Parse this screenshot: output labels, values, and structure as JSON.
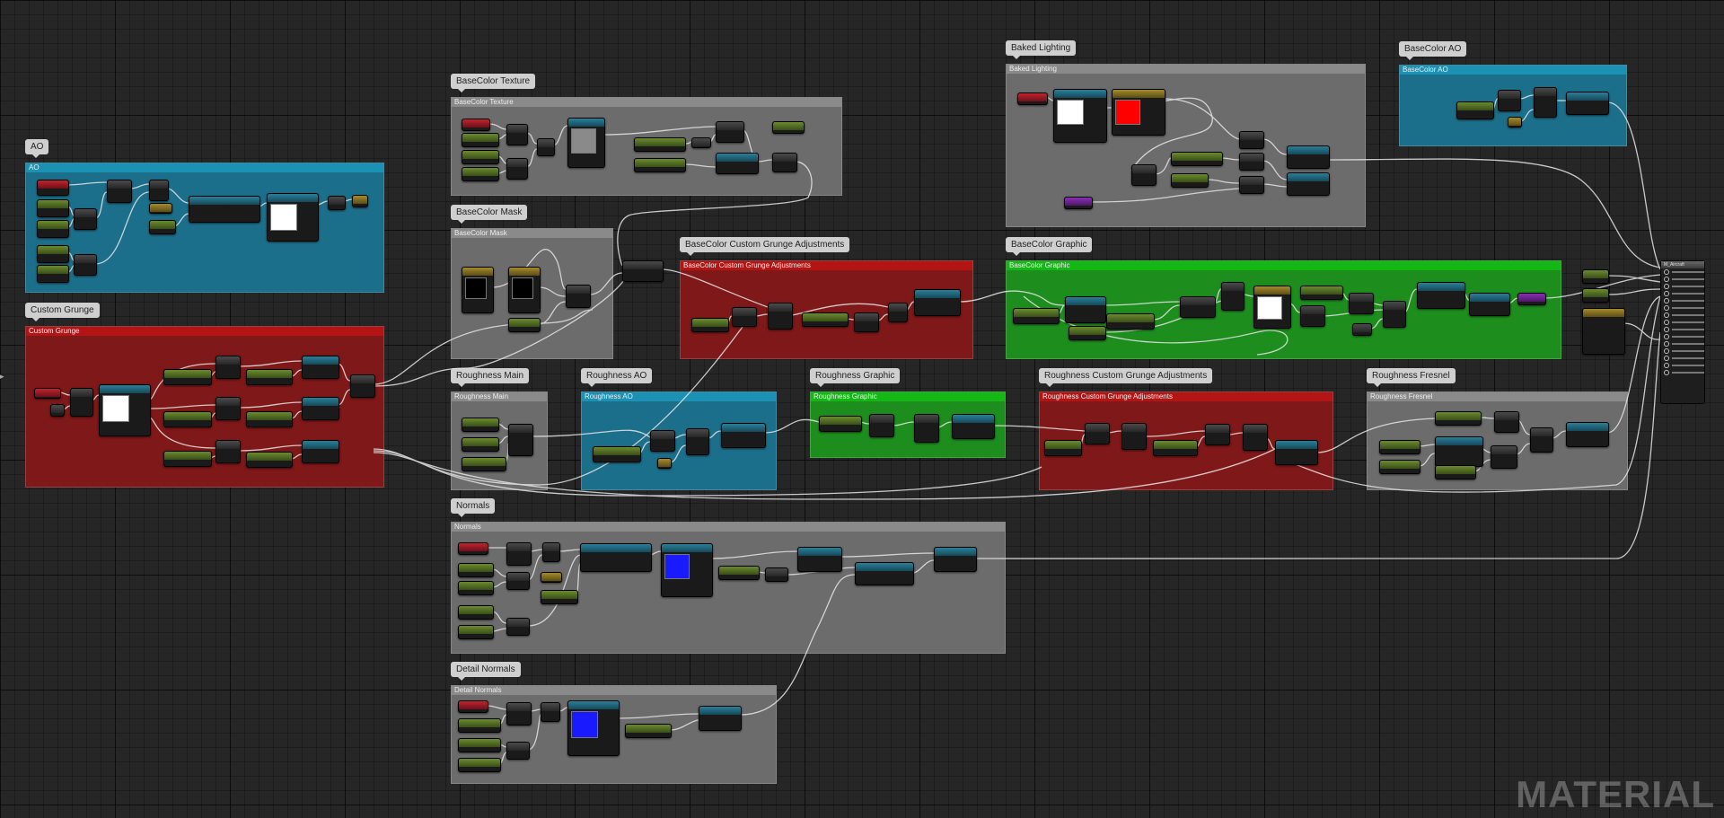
{
  "editor": {
    "watermark": "MATERIAL",
    "output_node_label": "M_Aircraft"
  },
  "comments": [
    {
      "id": "ao",
      "label": "AO",
      "header": "AO",
      "color": "teal"
    },
    {
      "id": "custom-grunge",
      "label": "Custom Grunge",
      "header": "Custom Grunge",
      "color": "red"
    },
    {
      "id": "basecolor-texture",
      "label": "BaseColor Texture",
      "header": "BaseColor Texture",
      "color": "gray"
    },
    {
      "id": "basecolor-mask",
      "label": "BaseColor Mask",
      "header": "BaseColor Mask",
      "color": "gray"
    },
    {
      "id": "basecolor-custom-grunge",
      "label": "BaseColor Custom Grunge Adjustments",
      "header": "BaseColor Custom Grunge Adjustments",
      "color": "red"
    },
    {
      "id": "baked-lighting",
      "label": "Baked Lighting",
      "header": "Baked Lighting",
      "color": "gray"
    },
    {
      "id": "basecolor-ao",
      "label": "BaseColor AO",
      "header": "BaseColor AO",
      "color": "teal"
    },
    {
      "id": "basecolor-graphic",
      "label": "BaseColor Graphic",
      "header": "BaseColor Graphic",
      "color": "green"
    },
    {
      "id": "roughness-main",
      "label": "Roughness Main",
      "header": "Roughness Main",
      "color": "gray"
    },
    {
      "id": "roughness-ao",
      "label": "Roughness AO",
      "header": "Roughness AO",
      "color": "teal"
    },
    {
      "id": "roughness-graphic",
      "label": "Roughness Graphic",
      "header": "Roughness Graphic",
      "color": "green"
    },
    {
      "id": "roughness-custom-grunge",
      "label": "Roughness Custom Grunge Adjustments",
      "header": "Roughness Custom Grunge Adjustments",
      "color": "red"
    },
    {
      "id": "roughness-fresnel",
      "label": "Roughness Fresnel",
      "header": "Roughness Fresnel",
      "color": "gray"
    },
    {
      "id": "normals",
      "label": "Normals",
      "header": "Normals",
      "color": "gray"
    },
    {
      "id": "detail-normals",
      "label": "Detail Normals",
      "header": "Detail Normals",
      "color": "gray"
    }
  ],
  "colors": {
    "teal_frame": "#1c6f8a",
    "red_frame": "#7f1818",
    "green_frame": "#1d8e1d",
    "gray_frame": "#6c6c6c",
    "wire": "#e6e6e6"
  }
}
